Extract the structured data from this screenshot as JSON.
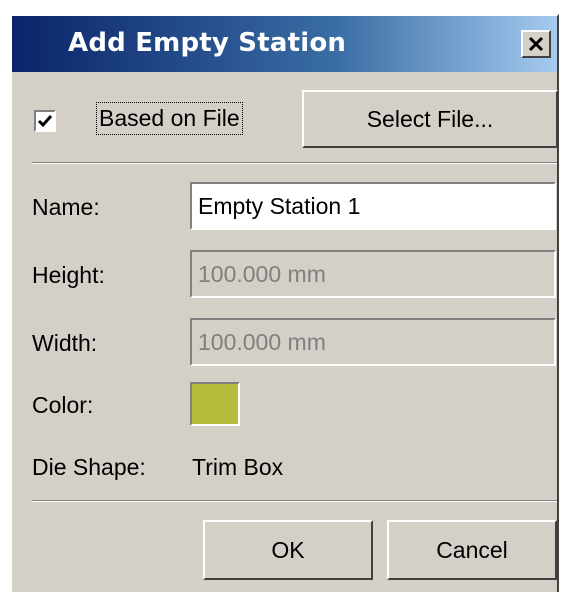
{
  "window": {
    "title": "Add Empty Station"
  },
  "based_on_file": {
    "label": "Based on File",
    "checked": true
  },
  "buttons": {
    "select_file": "Select File...",
    "ok": "OK",
    "cancel": "Cancel"
  },
  "fields": {
    "name": {
      "label": "Name:",
      "value": "Empty Station 1",
      "enabled": true
    },
    "height": {
      "label": "Height:",
      "value": "100.000 mm",
      "enabled": false
    },
    "width": {
      "label": "Width:",
      "value": "100.000 mm",
      "enabled": false
    },
    "color": {
      "label": "Color:",
      "value": "#b5bc3c"
    },
    "die_shape": {
      "label": "Die Shape:",
      "value": "Trim Box"
    }
  },
  "colors": {
    "titlebar_start": "#0a246a",
    "titlebar_end": "#a6caf0",
    "face": "#d4d0c8"
  },
  "icons": {
    "close": "close-icon",
    "check": "checkmark-icon"
  }
}
